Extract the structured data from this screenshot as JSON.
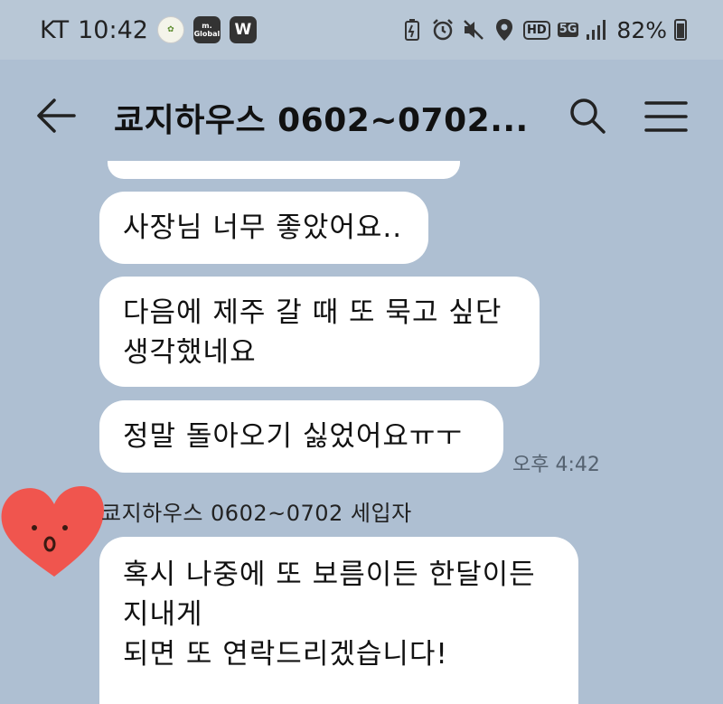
{
  "status_bar": {
    "carrier": "KT",
    "time": "10:42",
    "notification_icons": [
      "app-icon-a",
      "m-global-icon",
      "w-icon"
    ],
    "m_global_text": "m. Global",
    "w_text": "W",
    "hd_text": "HD",
    "network_text": "5G",
    "battery": "82%"
  },
  "header": {
    "title": "쿄지하우스 0602~0702..."
  },
  "messages": [
    {
      "text": "사장님 너무 좋았어요.."
    },
    {
      "line1": "다음에 제주 갈 때 또 묵고 싶단",
      "line2": "생각했네요"
    },
    {
      "text": "정말 돌아오기 싫었어요ㅠㅜ",
      "time": "오후 4:42"
    }
  ],
  "incoming": {
    "sender": "쿄지하우스 0602~0702 세입자",
    "line1": "혹시 나중에 또 보름이든 한달이든",
    "line2": "지내게",
    "line3": "되면 또 연락드리겠습니다!"
  },
  "colors": {
    "background": "#aebfd2",
    "bubble": "#ffffff",
    "avatar_heart": "#f0554e"
  }
}
